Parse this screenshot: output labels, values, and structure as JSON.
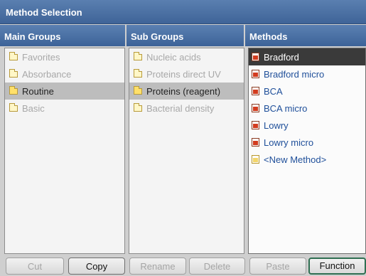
{
  "window": {
    "title": "Method Selection"
  },
  "columns": {
    "main_groups": "Main Groups",
    "sub_groups": "Sub Groups",
    "methods": "Methods"
  },
  "main_groups": [
    {
      "label": "Favorites",
      "selected": false
    },
    {
      "label": "Absorbance",
      "selected": false
    },
    {
      "label": "Routine",
      "selected": true
    },
    {
      "label": "Basic",
      "selected": false
    }
  ],
  "sub_groups": [
    {
      "label": "Nucleic acids",
      "selected": false
    },
    {
      "label": "Proteins direct UV",
      "selected": false
    },
    {
      "label": "Proteins (reagent)",
      "selected": true
    },
    {
      "label": "Bacterial density",
      "selected": false
    }
  ],
  "methods": [
    {
      "label": "Bradford",
      "selected": true,
      "icon": "method-icon"
    },
    {
      "label": "Bradford micro",
      "selected": false,
      "icon": "method-icon"
    },
    {
      "label": "BCA",
      "selected": false,
      "icon": "method-icon"
    },
    {
      "label": "BCA micro",
      "selected": false,
      "icon": "method-icon"
    },
    {
      "label": "Lowry",
      "selected": false,
      "icon": "method-icon"
    },
    {
      "label": "Lowry micro",
      "selected": false,
      "icon": "method-icon"
    },
    {
      "label": "<New Method>",
      "selected": false,
      "icon": "new-method-icon"
    }
  ],
  "buttons": {
    "cut": "Cut",
    "copy": "Copy",
    "rename": "Rename",
    "delete": "Delete",
    "paste": "Paste",
    "function": "Function"
  },
  "colors": {
    "header": "#3f6498",
    "selected_method": "#3a3a3a",
    "method_text": "#1f4f9a",
    "function_border": "#2f6f52"
  }
}
